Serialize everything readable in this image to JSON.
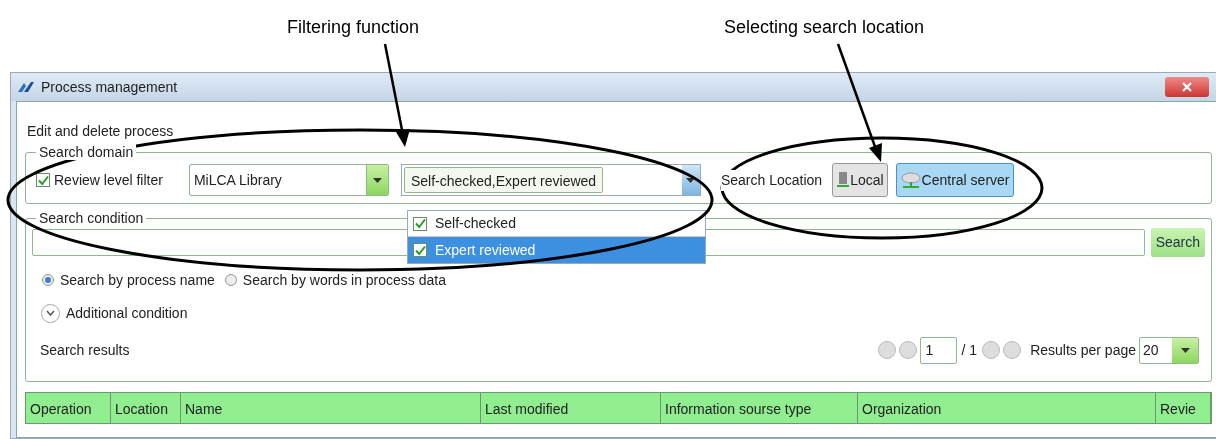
{
  "annotations": [
    {
      "text": "Filtering function"
    },
    {
      "text": "Selecting search location"
    }
  ],
  "window": {
    "title": "Process management"
  },
  "section_title": "Edit and delete process",
  "search_domain": {
    "legend": "Search domain",
    "review_filter": {
      "label": "Review level filter",
      "checked": true
    },
    "library": {
      "value": "MiLCA Library"
    },
    "levels": {
      "value": "Self-checked,Expert reviewed",
      "expanded": true,
      "options": [
        {
          "label": "Self-checked",
          "checked": true,
          "selected": false
        },
        {
          "label": "Expert reviewed",
          "checked": true,
          "selected": true
        }
      ]
    },
    "location_label": "Search Location",
    "locations": [
      {
        "label": "Local",
        "kind": "local",
        "selected": false
      },
      {
        "label": "Central server",
        "kind": "server",
        "selected": true
      }
    ]
  },
  "search_condition": {
    "legend": "Search condition",
    "search_button": "Search",
    "modes": [
      {
        "label": "Search by process name",
        "selected": true
      },
      {
        "label": "Search by words in process data",
        "selected": false
      }
    ],
    "additional": "Additional condition",
    "results_label": "Search results",
    "pager": {
      "page": "1",
      "total": "/ 1",
      "per_page_label": "Results per page",
      "per_page": "20"
    }
  },
  "table": {
    "columns": [
      "Operation",
      "Location",
      "Name",
      "Last modified",
      "Information sourse type",
      "Organization",
      "Revie"
    ]
  }
}
